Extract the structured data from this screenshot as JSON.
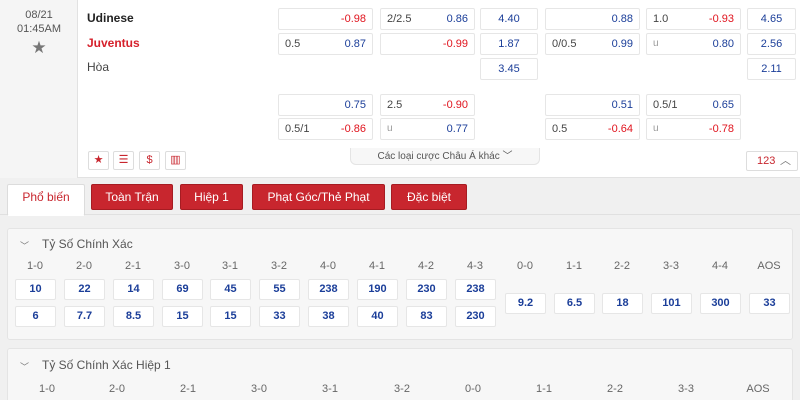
{
  "match": {
    "date": "08/21",
    "time": "01:45AM",
    "home": "Udinese",
    "away": "Juventus",
    "draw": "Hòa",
    "rows": [
      [
        {
          "h": "",
          "v": "-0.98",
          "c": "red"
        },
        {
          "h": "2/2.5",
          "v": "0.86",
          "c": "blue"
        },
        {
          "v": "4.40"
        },
        {
          "h": "",
          "v": "0.88",
          "c": "blue"
        },
        {
          "h": "1.0",
          "v": "-0.93",
          "c": "red"
        },
        {
          "v": "4.65"
        }
      ],
      [
        {
          "h": "0.5",
          "v": "0.87",
          "c": "blue"
        },
        {
          "h": "",
          "v": "-0.99",
          "c": "red"
        },
        {
          "v": "1.87"
        },
        {
          "h": "0/0.5",
          "v": "0.99",
          "c": "blue"
        },
        {
          "h": "u",
          "v": "0.80",
          "c": "blue"
        },
        {
          "v": "2.56"
        }
      ],
      [
        null,
        null,
        {
          "v": "3.45"
        },
        null,
        null,
        {
          "v": "2.11"
        }
      ],
      [
        {
          "h": "",
          "v": "0.75",
          "c": "blue"
        },
        {
          "h": "2.5",
          "v": "-0.90",
          "c": "red"
        },
        null,
        {
          "h": "",
          "v": "0.51",
          "c": "blue"
        },
        {
          "h": "0.5/1",
          "v": "0.65",
          "c": "blue"
        },
        null
      ],
      [
        {
          "h": "0.5/1",
          "v": "-0.86",
          "c": "red"
        },
        {
          "h": "u",
          "v": "0.77",
          "c": "blue"
        },
        null,
        {
          "h": "0.5",
          "v": "-0.64",
          "c": "red"
        },
        {
          "h": "u",
          "v": "-0.78",
          "c": "red"
        },
        null
      ]
    ],
    "more_bets": "Các loại cược Châu Á khác",
    "count": "123"
  },
  "icons": [
    "star-icon",
    "tv-icon",
    "dollar-icon",
    "stats-icon"
  ],
  "icon_glyphs": [
    "★",
    "☰",
    "$",
    "▥"
  ],
  "tabs": [
    "Phổ biến",
    "Toàn Trận",
    "Hiệp 1",
    "Phạt Góc/Thẻ Phạt",
    "Đặc biệt"
  ],
  "exact_score": {
    "title": "Tỷ Số Chính Xác",
    "headers": [
      "1-0",
      "2-0",
      "2-1",
      "3-0",
      "3-1",
      "3-2",
      "4-0",
      "4-1",
      "4-2",
      "4-3",
      "0-0",
      "1-1",
      "2-2",
      "3-3",
      "4-4",
      "AOS"
    ],
    "home_odds": [
      "10",
      "22",
      "14",
      "69",
      "45",
      "55",
      "238",
      "190",
      "230",
      "238"
    ],
    "away_odds": [
      "6",
      "7.7",
      "8.5",
      "15",
      "15",
      "33",
      "38",
      "40",
      "83",
      "230"
    ],
    "draw_odds": [
      "9.2",
      "6.5",
      "18",
      "101",
      "300",
      "33"
    ]
  },
  "exact_score_h1": {
    "title": "Tỷ Số Chính Xác Hiệp 1",
    "headers": [
      "1-0",
      "2-0",
      "2-1",
      "3-0",
      "3-1",
      "3-2",
      "0-0",
      "1-1",
      "2-2",
      "3-3",
      "AOS"
    ]
  }
}
